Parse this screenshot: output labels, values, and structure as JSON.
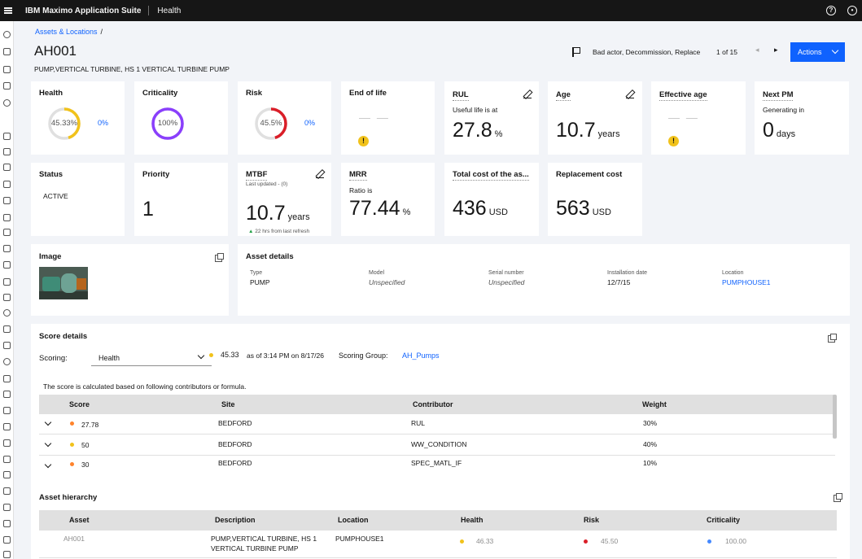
{
  "topbar": {
    "brand": "IBM Maximo Application Suite",
    "app": "Health",
    "help_icon": "help-icon",
    "user_icon": "user-avatar-icon"
  },
  "breadcrumb": {
    "link": "Assets & Locations",
    "sep": "/"
  },
  "header": {
    "asset_id": "AH001",
    "description": "PUMP,VERTICAL TURBINE, HS 1 VERTICAL TURBINE PUMP",
    "flags": "Bad actor, Decommission, Replace",
    "pager": "1 of 15",
    "actions_label": "Actions"
  },
  "colors": {
    "accent": "#0f62fe",
    "health": "#f1c21b",
    "risk": "#da1e28",
    "criticality": "#8a3ffc",
    "trend": "#24a148"
  },
  "cards": {
    "health": {
      "title": "Health",
      "value": "45.33%",
      "pct": "0%",
      "fraction": 0.4533
    },
    "criticality": {
      "title": "Criticality",
      "value": "100%",
      "fraction": 1.0
    },
    "risk": {
      "title": "Risk",
      "value": "45.5%",
      "pct": "0%",
      "fraction": 0.455
    },
    "eol": {
      "title": "End of life",
      "dash": "— —",
      "warn": "!"
    },
    "rul": {
      "title": "RUL",
      "sub": "Useful life is at",
      "value": "27.8",
      "unit": "%"
    },
    "age": {
      "title": "Age",
      "value": "10.7",
      "unit": "years"
    },
    "eff_age": {
      "title": "Effective age",
      "dash": "— —",
      "warn": "!"
    },
    "next_pm": {
      "title": "Next PM",
      "sub": "Generating in",
      "value": "0",
      "unit": "days"
    },
    "status": {
      "title": "Status",
      "value": "ACTIVE"
    },
    "priority": {
      "title": "Priority",
      "value": "1"
    },
    "mtbf": {
      "title": "MTBF",
      "updated": "Last updated - (0)",
      "value": "10.7",
      "unit": "years",
      "trend_arrow": "▲",
      "trend": "22 hrs from last refresh"
    },
    "mrr": {
      "title": "MRR",
      "sub": "Ratio is",
      "value": "77.44",
      "unit": "%"
    },
    "total_cost": {
      "title": "Total cost of the as...",
      "value": "436",
      "unit": "USD"
    },
    "replacement": {
      "title": "Replacement cost",
      "value": "563",
      "unit": "USD"
    }
  },
  "image_card": {
    "title": "Image"
  },
  "asset_details": {
    "title": "Asset details",
    "fields": [
      {
        "label": "Type",
        "value": "PUMP"
      },
      {
        "label": "Model",
        "value": "Unspecified"
      },
      {
        "label": "Serial number",
        "value": "Unspecified"
      },
      {
        "label": "Installation date",
        "value": "12/7/15"
      },
      {
        "label": "Location",
        "value": "PUMPHOUSE1"
      }
    ]
  },
  "score": {
    "title": "Score details",
    "scoring_label": "Scoring:",
    "scoring_value": "Health",
    "score": "45.33",
    "as_of": "as of 3:14 PM on 8/17/26",
    "group_label": "Scoring Group:",
    "group_value": "AH_Pumps",
    "note": "The score is calculated based on following contributors or formula.",
    "columns": [
      "Score",
      "Site",
      "Contributor",
      "Weight"
    ],
    "rows": [
      {
        "score": "27.78",
        "site": "BEDFORD",
        "contributor": "RUL",
        "weight": "30%",
        "color": "#ff832b"
      },
      {
        "score": "50",
        "site": "BEDFORD",
        "contributor": "WW_CONDITION",
        "weight": "40%",
        "color": "#f1c21b"
      },
      {
        "score": "30",
        "site": "BEDFORD",
        "contributor": "SPEC_MATL_IF",
        "weight": "10%",
        "color": "#ff832b"
      }
    ]
  },
  "hierarchy": {
    "title": "Asset hierarchy",
    "columns": [
      "Asset",
      "Description",
      "Location",
      "Health",
      "Risk",
      "Criticality"
    ],
    "rows": [
      {
        "asset": "AH001",
        "desc1": "PUMP,VERTICAL TURBINE, HS 1",
        "desc2": "VERTICAL TURBINE PUMP",
        "location": "PUMPHOUSE1",
        "health": "46.33",
        "risk": "45.50",
        "criticality": "100.00"
      }
    ]
  }
}
